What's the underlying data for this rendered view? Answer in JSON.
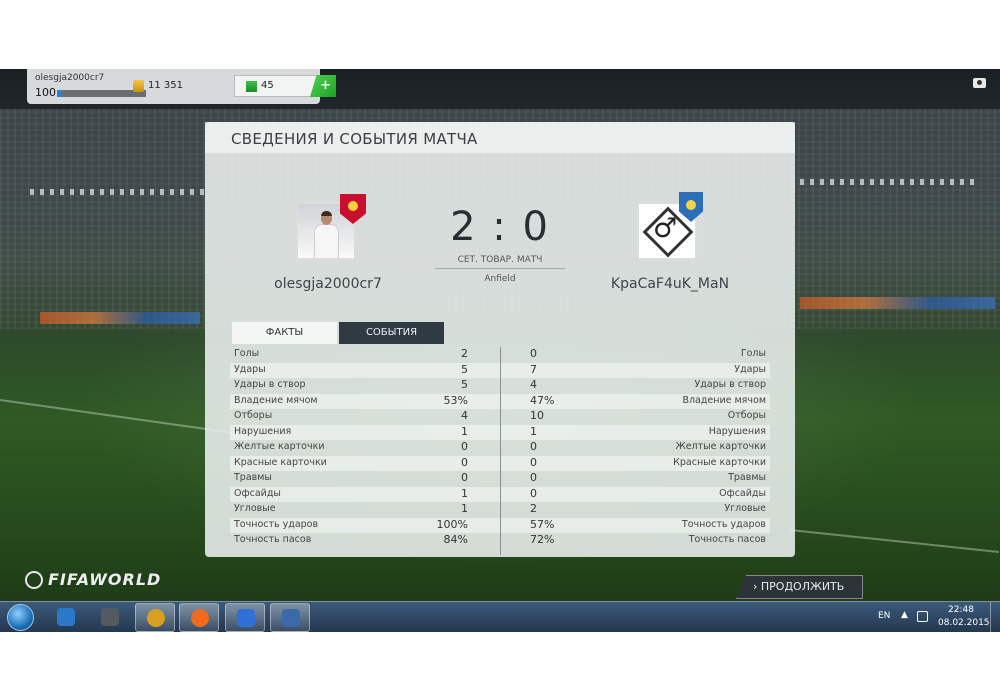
{
  "status": {
    "username": "olesgja2000cr7",
    "level": "100",
    "level_progress": 0.05,
    "coins": "11 351",
    "points": "45",
    "add_label": "+"
  },
  "panel": {
    "title": "СВЕДЕНИЯ И СОБЫТИЯ МАТЧА",
    "home_name": "olesgja2000cr7",
    "away_name": "KpaCaF4uK_MaN",
    "score": "2 : 0",
    "match_type": "СЕТ. ТОВАР. МАТЧ",
    "venue": "Anfield",
    "away_symbol": "♂",
    "tabs": [
      {
        "label": "ФАКТЫ",
        "active": false
      },
      {
        "label": "СОБЫТИЯ",
        "active": true
      }
    ]
  },
  "stats": [
    {
      "left_label": "Голы",
      "home": "2",
      "away": "0",
      "right_label": "Голы"
    },
    {
      "left_label": "Удары",
      "home": "5",
      "away": "7",
      "right_label": "Удары"
    },
    {
      "left_label": "Удары в створ",
      "home": "5",
      "away": "4",
      "right_label": "Удары в створ"
    },
    {
      "left_label": "Владение мячом",
      "home": "53%",
      "away": "47%",
      "right_label": "Владение мячом"
    },
    {
      "left_label": "Отборы",
      "home": "4",
      "away": "10",
      "right_label": "Отборы"
    },
    {
      "left_label": "Нарушения",
      "home": "1",
      "away": "1",
      "right_label": "Нарушения"
    },
    {
      "left_label": "Желтые карточки",
      "home": "0",
      "away": "0",
      "right_label": "Желтые карточки"
    },
    {
      "left_label": "Красные карточки",
      "home": "0",
      "away": "0",
      "right_label": "Красные карточки"
    },
    {
      "left_label": "Травмы",
      "home": "0",
      "away": "0",
      "right_label": "Травмы"
    },
    {
      "left_label": "Офсайды",
      "home": "1",
      "away": "0",
      "right_label": "Офсайды"
    },
    {
      "left_label": "Угловые",
      "home": "1",
      "away": "2",
      "right_label": "Угловые"
    },
    {
      "left_label": "Точность ударов",
      "home": "100%",
      "away": "57%",
      "right_label": "Точность ударов"
    },
    {
      "left_label": "Точность пасов",
      "home": "84%",
      "away": "72%",
      "right_label": "Точность пасов"
    }
  ],
  "logo": {
    "text": "FIFAWORLD"
  },
  "continue_label": "› ПРОДОЛЖИТЬ",
  "taskbar": {
    "apps": [
      {
        "name": "media-player-icon",
        "color": "#2a78c8",
        "active": false
      },
      {
        "name": "film-icon",
        "color": "#555a60",
        "active": false
      },
      {
        "name": "chrome-icon",
        "color": "#d8a020",
        "active": true
      },
      {
        "name": "origin-icon",
        "color": "#f06a20",
        "active": true
      },
      {
        "name": "fifa-world-icon",
        "color": "#2f6fd6",
        "active": true
      },
      {
        "name": "screen-app-icon",
        "color": "#3b6aa8",
        "active": true
      }
    ],
    "lang": "EN",
    "time": "22:48",
    "date": "08.02.2015"
  },
  "colors": {
    "accent_green": "#20a02a",
    "events_tab": "#2f3a42",
    "taskbar": "#24384f"
  }
}
